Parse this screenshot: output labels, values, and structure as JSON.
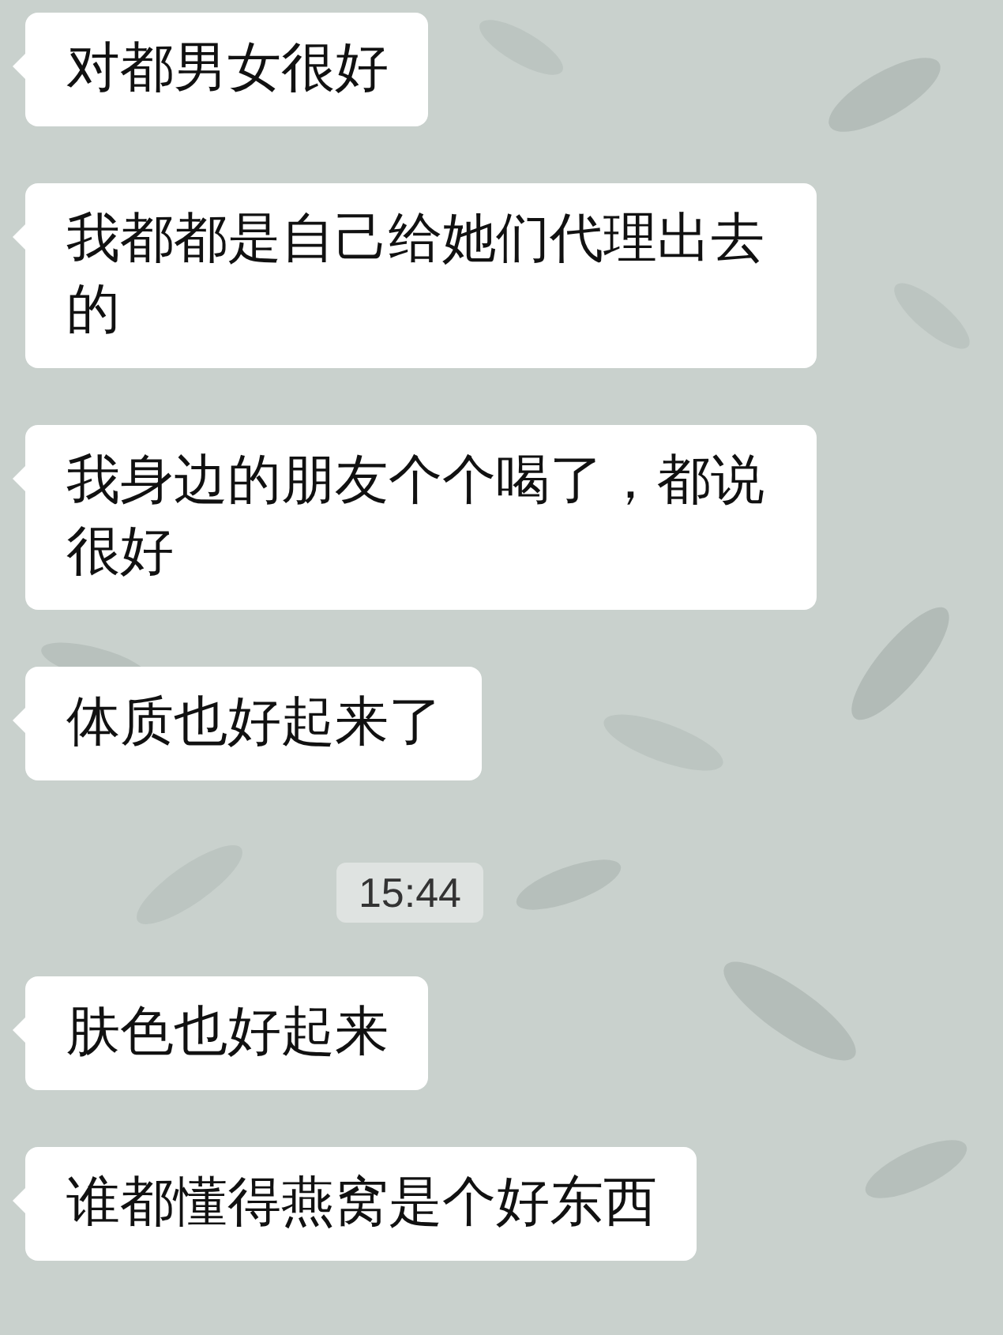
{
  "messages": [
    {
      "kind": "text",
      "text": "对都男女很好"
    },
    {
      "kind": "text",
      "text": "我都都是自己给她们代理出去的"
    },
    {
      "kind": "text",
      "text": "我身边的朋友个个喝了，都说很好"
    },
    {
      "kind": "text",
      "text": "体质也好起来了"
    },
    {
      "kind": "time",
      "text": "15:44"
    },
    {
      "kind": "text",
      "text": "肤色也好起来"
    },
    {
      "kind": "text",
      "text": "谁都懂得燕窝是个好东西"
    }
  ]
}
